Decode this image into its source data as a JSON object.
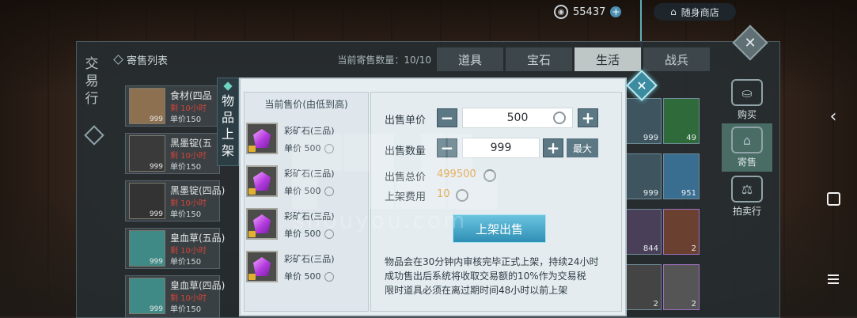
{
  "top": {
    "currency_amount": "55437",
    "shop_label": "随身商店"
  },
  "market": {
    "side_title": [
      "交",
      "易",
      "行"
    ],
    "list_title": "寄售列表",
    "listing_count": "当前寄售数量：10/10",
    "tabs": [
      "道具",
      "宝石",
      "生活",
      "战兵"
    ],
    "active_tab": "生活",
    "rows": [
      {
        "name": "食材(四品",
        "time": "剩 10小时",
        "price": "单价150",
        "qty": "999"
      },
      {
        "name": "黑墨锭(五",
        "time": "剩 10小时",
        "price": "单价150",
        "qty": "999"
      },
      {
        "name": "黑墨锭(四品)",
        "time": "剩 10小时",
        "price": "单价150",
        "qty": "999"
      },
      {
        "name": "皇血草(五品)",
        "time": "剩 10小时",
        "price": "单价150",
        "qty": "999"
      },
      {
        "name": "皇血草(四品)",
        "time": "剩 10小时",
        "price": "单价150",
        "qty": "999"
      }
    ],
    "grid_quantities": [
      "999",
      "49",
      "999",
      "951",
      "844",
      "2",
      "2",
      "2"
    ],
    "side_buttons": [
      "购买",
      "寄售",
      "拍卖行"
    ]
  },
  "dialog": {
    "tab_title": [
      "物",
      "品",
      "上",
      "架"
    ],
    "price_list_title": "当前售价(由低到高)",
    "price_items": [
      {
        "name": "彩矿石(三品)",
        "price_label": "单价",
        "price": "500"
      },
      {
        "name": "彩矿石(三品)",
        "price_label": "单价",
        "price": "500"
      },
      {
        "name": "彩矿石(三品)",
        "price_label": "单价",
        "price": "500"
      },
      {
        "name": "彩矿石(三品)",
        "price_label": "单价",
        "price": "500"
      }
    ],
    "unit_price_label": "出售单价",
    "unit_price_value": "500",
    "quantity_label": "出售数量",
    "quantity_value": "999",
    "max_label": "最大",
    "total_label": "出售总价",
    "total_value": "499500",
    "fee_label": "上架费用",
    "fee_value": "10",
    "submit_label": "上架出售",
    "notice_lines": [
      "物品会在30分钟内审核完毕正式上架，持续24小时",
      "成功售出后系统将收取交易额的10%作为交易税",
      "限时道具必须在离过期时间48小时以前上架"
    ],
    "watermark_text": "shouyou.com"
  },
  "colors": {
    "accent": "#3c8ca1",
    "total_value": "#e0a040",
    "fee_value": "#e0a040",
    "time_red": "#d0443a"
  },
  "icons": [
    "coin-icon",
    "plus-icon",
    "shop-icon",
    "close-icon",
    "minus-icon",
    "gem-icon",
    "lock-icon",
    "back-icon",
    "home-icon",
    "menu-icon"
  ]
}
